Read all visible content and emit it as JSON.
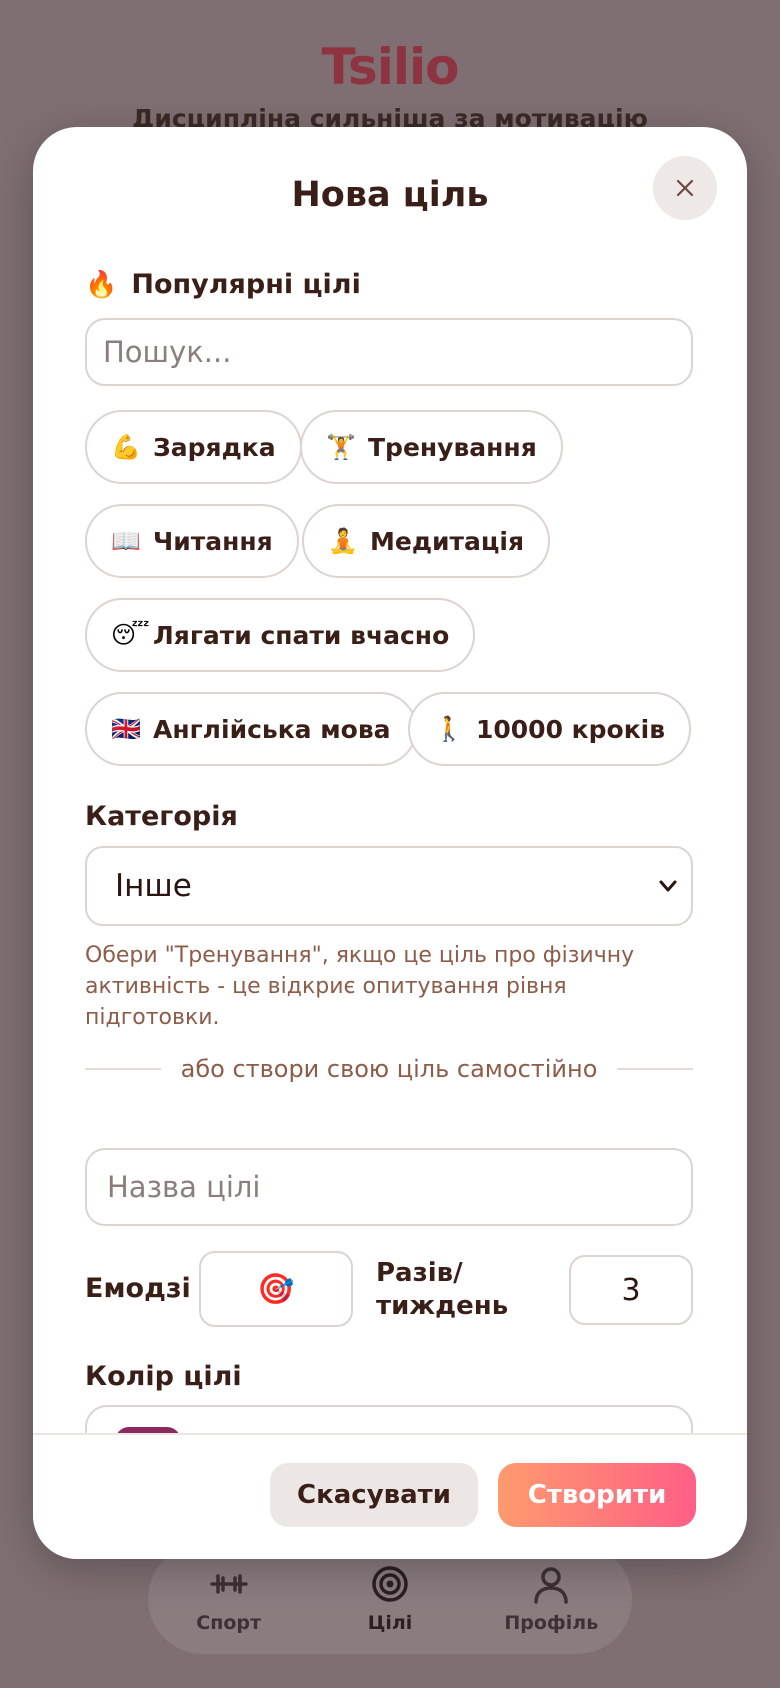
{
  "background": {
    "logo": "Tsilio",
    "tagline": "Дисципліна сильніша за мотивацію"
  },
  "nav": [
    {
      "label": "Спорт",
      "icon": "dumbbell-icon"
    },
    {
      "label": "Цілі",
      "icon": "target-icon",
      "active": true
    },
    {
      "label": "Профіль",
      "icon": "person-icon"
    }
  ],
  "modal": {
    "title": "Нова ціль",
    "popular_title": "Популярні цілі",
    "popular_icon": "🔥",
    "search_placeholder": "Пошук...",
    "chips": [
      {
        "emoji": "💪",
        "label": "Зарядка"
      },
      {
        "emoji": "🏋️",
        "label": "Тренування"
      },
      {
        "emoji": "📖",
        "label": "Читання"
      },
      {
        "emoji": "🧘",
        "label": "Медитація"
      },
      {
        "emoji": "😴",
        "label": "Лягати спати вчасно"
      },
      {
        "emoji": "🇬🇧",
        "label": "Англійська мова"
      },
      {
        "emoji": "🚶",
        "label": "10000 кроків"
      }
    ],
    "category_label": "Категорія",
    "category_value": "Інше",
    "category_hint": "Обери \"Тренування\", якщо це ціль про фізичну активність - це відкриє опитування рівня підготовки.",
    "divider_text": "або створи свою ціль самостійно",
    "name_placeholder": "Назва цілі",
    "emoji_label": "Емодзі",
    "emoji_value": "🎯",
    "times_label": "Разів/ тиждень",
    "times_value": "3",
    "color_label": "Колір цілі",
    "color_value": "#8a2a5e",
    "cancel_label": "Скасувати",
    "create_label": "Створити"
  },
  "colors": {
    "accent_start": "#ff9a6e",
    "accent_end": "#ff5f86",
    "text_dark": "#3a1f18",
    "hint": "#8b5d4a"
  }
}
